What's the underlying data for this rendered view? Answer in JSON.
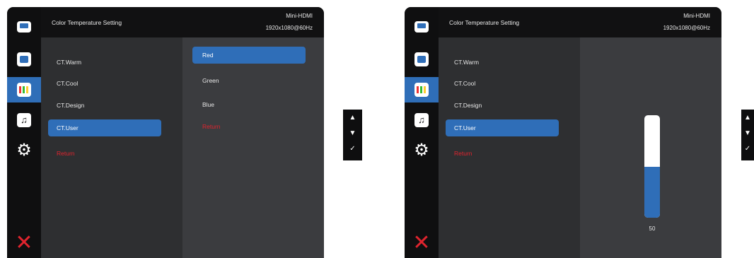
{
  "colors": {
    "accent": "#2f6eb8",
    "return_red": "#e0242e",
    "panel": "#2e2f31",
    "subpanel": "#3b3c3f"
  },
  "osd": {
    "title": "Color Temperature Setting",
    "source": "Mini-HDMI",
    "resolution": "1920x1080@60Hz",
    "menu_items": [
      "CT.Warm",
      "CT.Cool",
      "CT.Design",
      "CT.User",
      "Return"
    ],
    "selected_item": "CT.User",
    "sidebar_icons": [
      "monitor-icon",
      "image-icon",
      "color-bars-icon",
      "music-icon",
      "gear-icon",
      "close-icon"
    ]
  },
  "left_submenu": {
    "items": [
      "Red",
      "Green",
      "Blue",
      "Return"
    ],
    "selected": "Red"
  },
  "right_slider": {
    "value": "50",
    "level_fraction": 0.5
  },
  "nav_keys": {
    "up": "▲",
    "down": "▼",
    "confirm": "✓"
  }
}
